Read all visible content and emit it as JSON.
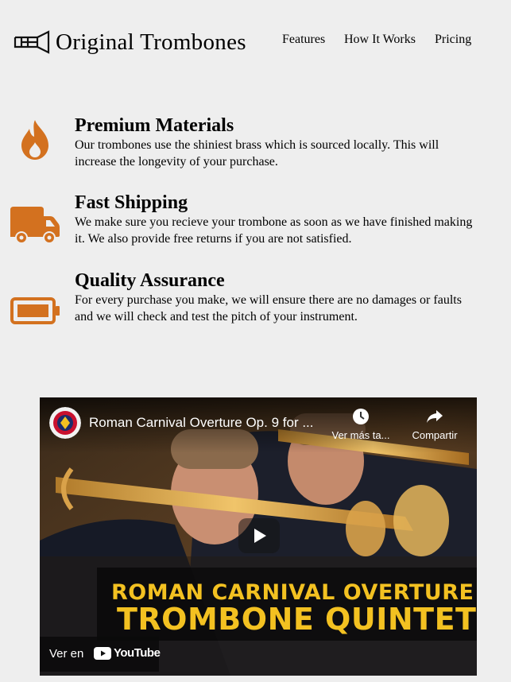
{
  "brand": {
    "name": "Original Trombones",
    "accent": "#d3711f"
  },
  "nav": [
    {
      "label": "Features"
    },
    {
      "label": "How It Works"
    },
    {
      "label": "Pricing"
    }
  ],
  "features": [
    {
      "icon": "fire-icon",
      "title": "Premium Materials",
      "text": "Our trombones use the shiniest brass which is sourced locally. This will increase the longevity of your purchase."
    },
    {
      "icon": "truck-icon",
      "title": "Fast Shipping",
      "text": "We make sure you recieve your trombone as soon as we have finished making it. We also provide free returns if you are not satisfied."
    },
    {
      "icon": "battery-icon",
      "title": "Quality Assurance",
      "text": "For every purchase you make, we will ensure there are no damages or faults and we will check and test the pitch of your instrument."
    }
  ],
  "video": {
    "title": "Roman Carnival Overture Op. 9 for ...",
    "watch_later": "Ver más ta...",
    "share": "Compartir",
    "banner_line1": "ROMAN CARNIVAL OVERTURE",
    "banner_line2": "TROMBONE QUINTET",
    "watch_on": "Ver en",
    "platform": "YouTube"
  }
}
